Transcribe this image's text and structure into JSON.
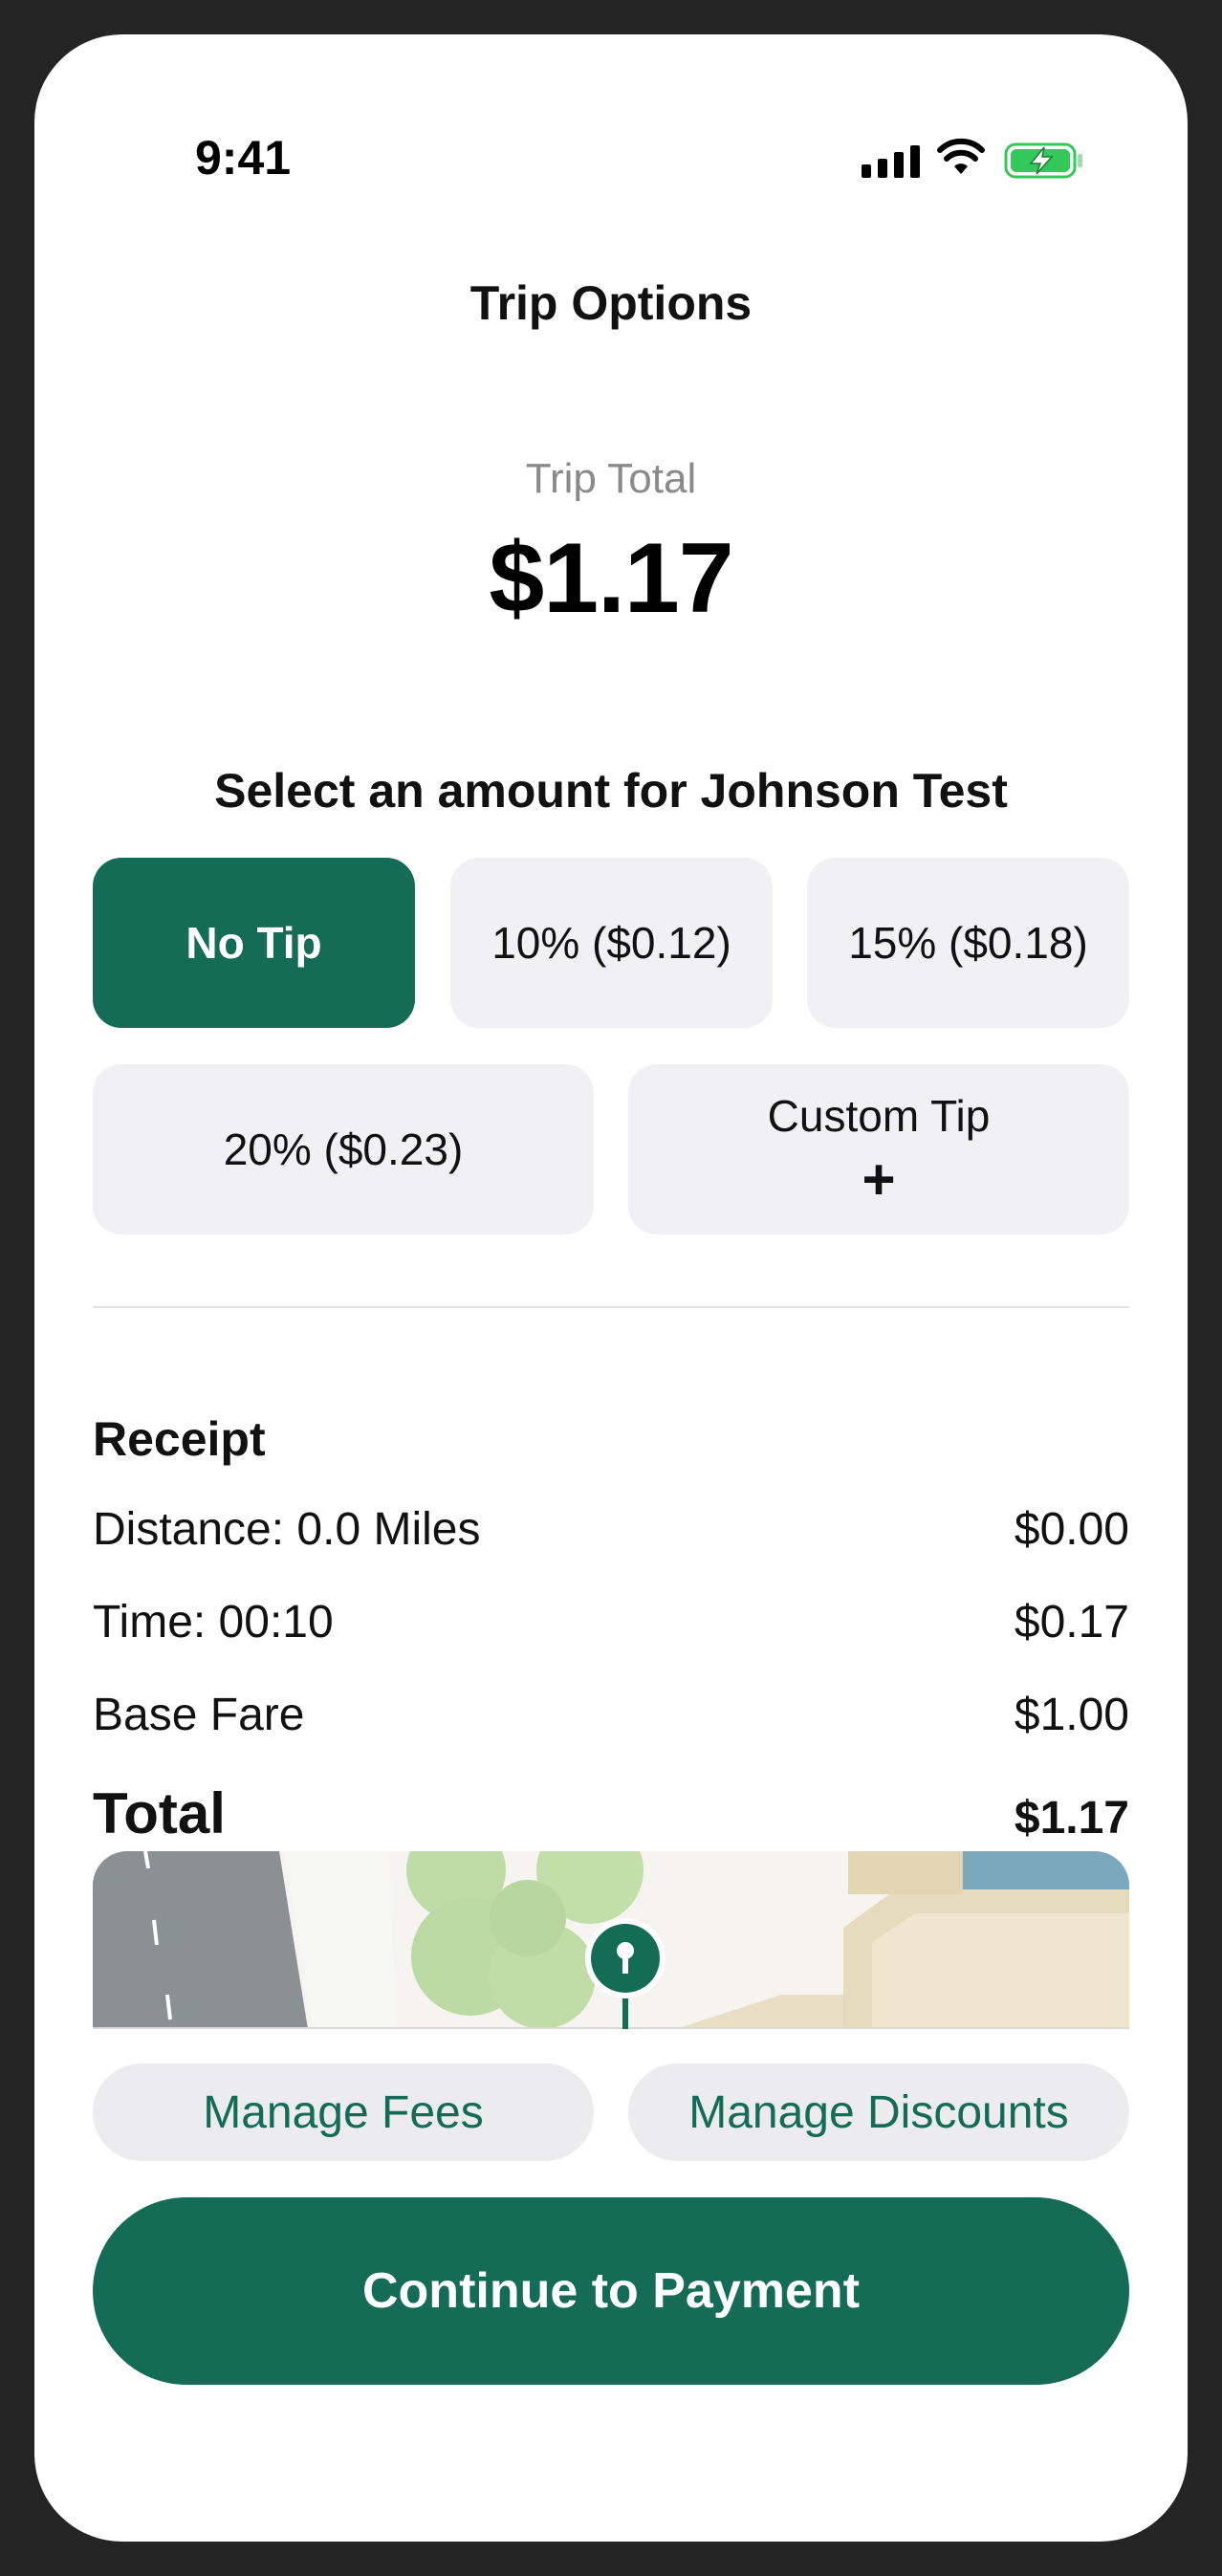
{
  "status_bar": {
    "time": "9:41"
  },
  "header": {
    "title": "Trip Options"
  },
  "summary": {
    "label": "Trip Total",
    "amount": "$1.17"
  },
  "tip_section": {
    "prompt": "Select an amount for Johnson Test",
    "options": [
      {
        "label": "No Tip",
        "selected": true
      },
      {
        "label": "10% ($0.12)",
        "selected": false
      },
      {
        "label": "15% ($0.18)",
        "selected": false
      },
      {
        "label": "20% ($0.23)",
        "selected": false
      },
      {
        "label": "Custom Tip",
        "selected": false
      }
    ],
    "custom_plus": "+"
  },
  "receipt": {
    "title": "Receipt",
    "rows": [
      {
        "label": "Distance: 0.0 Miles",
        "value": "$0.00"
      },
      {
        "label": "Time: 00:10",
        "value": "$0.17"
      },
      {
        "label": "Base Fare",
        "value": "$1.00"
      }
    ],
    "total": {
      "label": "Total",
      "value": "$1.17"
    }
  },
  "actions": {
    "manage_fees": "Manage Fees",
    "manage_discounts": "Manage Discounts",
    "continue": "Continue to Payment"
  },
  "colors": {
    "accent": "#146b56",
    "button_bg": "#f1f1f5",
    "battery_green": "#34c759"
  }
}
